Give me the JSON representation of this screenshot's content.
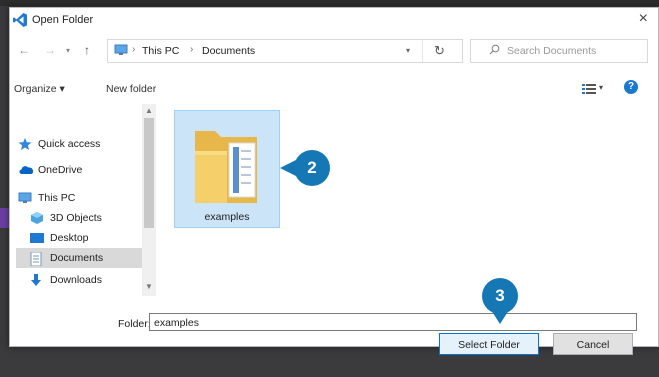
{
  "dialog": {
    "title": "Open Folder",
    "close_glyph": "×"
  },
  "address": {
    "icon": "this-pc-icon",
    "crumbs": [
      "This PC",
      "Documents"
    ],
    "separator": "›"
  },
  "search": {
    "placeholder": "Search Documents"
  },
  "toolbar": {
    "organize_label": "Organize ▾",
    "new_folder_label": "New folder",
    "help_glyph": "?"
  },
  "nav_pane": {
    "items": [
      {
        "label": "Quick access",
        "icon": "star-icon"
      },
      {
        "label": "OneDrive",
        "icon": "cloud-icon"
      },
      {
        "label": "This PC",
        "icon": "computer-icon"
      },
      {
        "label": "3D Objects",
        "icon": "cube-icon"
      },
      {
        "label": "Desktop",
        "icon": "desktop-icon"
      },
      {
        "label": "Documents",
        "icon": "documents-icon",
        "selected": true
      },
      {
        "label": "Downloads",
        "icon": "download-icon"
      }
    ]
  },
  "content": {
    "folder_name": "examples"
  },
  "footer": {
    "folder_label": "Folder:",
    "folder_value": "examples",
    "select_button": "Select Folder",
    "cancel_button": "Cancel"
  },
  "callouts": {
    "step2": "2",
    "step3": "3"
  },
  "colors": {
    "accent": "#0078d7",
    "callout": "#1578b4",
    "selection": "#cce4f7"
  }
}
